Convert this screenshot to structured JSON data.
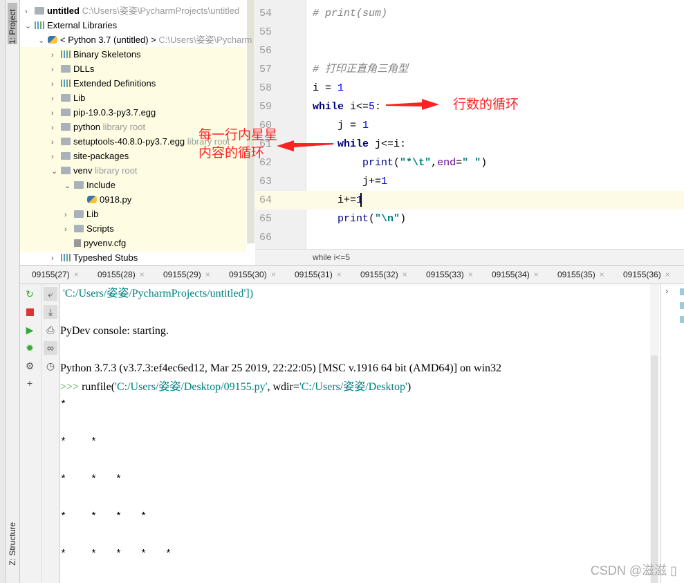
{
  "toolwindows": {
    "project": "1: Project",
    "structure": "Z: Structure"
  },
  "tree": [
    {
      "label": "untitled",
      "hint": "C:\\Users\\姿姿\\PycharmProjects\\untitled",
      "indent": 0,
      "chev": "›",
      "icon": "folder",
      "bold": true
    },
    {
      "label": "External Libraries",
      "hint": "",
      "indent": 0,
      "chev": "⌄",
      "icon": "lib"
    },
    {
      "label": "< Python 3.7 (untitled) >",
      "hint": "C:\\Users\\姿姿\\Pycharm",
      "indent": 1,
      "chev": "⌄",
      "icon": "python"
    },
    {
      "label": "Binary Skeletons",
      "hint": "",
      "indent": 2,
      "chev": "›",
      "icon": "lib"
    },
    {
      "label": "DLLs",
      "hint": "",
      "indent": 2,
      "chev": "›",
      "icon": "folder"
    },
    {
      "label": "Extended Definitions",
      "hint": "",
      "indent": 2,
      "chev": "›",
      "icon": "lib"
    },
    {
      "label": "Lib",
      "hint": "",
      "indent": 2,
      "chev": "›",
      "icon": "folder"
    },
    {
      "label": "pip-19.0.3-py3.7.egg",
      "hint": "",
      "indent": 2,
      "chev": "›",
      "icon": "folder"
    },
    {
      "label": "python",
      "hint": "library root",
      "indent": 2,
      "chev": "›",
      "icon": "folder"
    },
    {
      "label": "setuptools-40.8.0-py3.7.egg",
      "hint": "library root",
      "indent": 2,
      "chev": "›",
      "icon": "folder"
    },
    {
      "label": "site-packages",
      "hint": "",
      "indent": 2,
      "chev": "›",
      "icon": "folder"
    },
    {
      "label": "venv",
      "hint": "library root",
      "indent": 2,
      "chev": "⌄",
      "icon": "folder"
    },
    {
      "label": "Include",
      "hint": "",
      "indent": 3,
      "chev": "⌄",
      "icon": "folder"
    },
    {
      "label": "0918.py",
      "hint": "",
      "indent": 4,
      "chev": "",
      "icon": "python"
    },
    {
      "label": "Lib",
      "hint": "",
      "indent": 3,
      "chev": "›",
      "icon": "folder"
    },
    {
      "label": "Scripts",
      "hint": "",
      "indent": 3,
      "chev": "›",
      "icon": "folder"
    },
    {
      "label": "pyvenv.cfg",
      "hint": "",
      "indent": 3,
      "chev": "",
      "icon": "file"
    },
    {
      "label": "Typeshed Stubs",
      "hint": "",
      "indent": 2,
      "chev": "›",
      "icon": "lib"
    }
  ],
  "editor": {
    "line_numbers": [
      "54",
      "55",
      "56",
      "57",
      "58",
      "59",
      "60",
      "61",
      "62",
      "63",
      "64",
      "65",
      "66"
    ],
    "lines": [
      "<span class='cm'># print(sum)</span>",
      "",
      "",
      "<span class='cm'># 打印正直角三角型</span>",
      "i = <span class='num'>1</span>",
      "<span class='kw'>while</span> i&lt;=<span class='num'>5</span>:",
      "    j = <span class='num'>1</span>",
      "    <span class='kw'>while</span> j&lt;=i:",
      "        <span class='fn'>print</span>(<span class='str'>\"*\\t\"</span>,<span class='pa'>end</span>=<span class='str'>\" \"</span>)",
      "        j+=<span class='num'>1</span>",
      "    i+=<span class='num'>1</span>",
      "    <span class='fn'>print</span>(<span class='str'>\"\\n\"</span>)",
      ""
    ],
    "breadcrumb": "while i<=5"
  },
  "annotations": {
    "outer": "行数的循环",
    "inner_1": "每一行内星星",
    "inner_2": "内容的循环"
  },
  "console_tabs": [
    "09155(27)",
    "09155(28)",
    "09155(29)",
    "09155(30)",
    "09155(31)",
    "09155(32)",
    "09155(33)",
    "09155(34)",
    "09155(35)",
    "09155(36)"
  ],
  "console": {
    "line1": " 'C:/Users/姿姿/PycharmProjects/untitled'])",
    "line2": "PyDev console: starting.",
    "line3": "Python 3.7.3 (v3.7.3:ef4ec6ed12, Mar 25 2019, 22:22:05) [MSC v.1916 64 bit (AMD64)] on win32",
    "prompt": ">>>",
    "cmd_a": " runfile(",
    "cmd_b": "'C:/Users/姿姿/Desktop/09155.py'",
    "cmd_c": ", wdir=",
    "cmd_d": "'C:/Users/姿姿/Desktop'",
    "cmd_e": ")",
    "star_rows": [
      1,
      2,
      3,
      4,
      5
    ],
    "star": "*"
  },
  "watermark": "CSDN @滋滋 ▯"
}
